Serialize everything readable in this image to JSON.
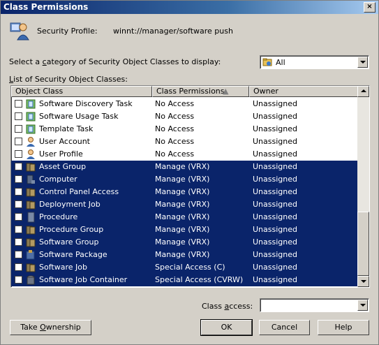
{
  "window": {
    "title": "Class Permissions",
    "close_glyph": "×"
  },
  "profile": {
    "label": "Security Profile:",
    "value": "winnt://manager/software push"
  },
  "category": {
    "label_pre": "Select a ",
    "label_accel": "c",
    "label_post": "ategory of Security Object Classes to display:",
    "selected": "All"
  },
  "list": {
    "label_pre": "",
    "label_accel": "L",
    "label_post": "ist of Security Object Classes:",
    "columns": [
      "Object Class",
      "Class Permissions",
      "Owner"
    ],
    "rows": [
      {
        "name": "Software Discovery Task",
        "perm": "No Access",
        "owner": "Unassigned",
        "selected": false,
        "icon": "task-icon"
      },
      {
        "name": "Software Usage Task",
        "perm": "No Access",
        "owner": "Unassigned",
        "selected": false,
        "icon": "task-icon"
      },
      {
        "name": "Template Task",
        "perm": "No Access",
        "owner": "Unassigned",
        "selected": false,
        "icon": "task-icon"
      },
      {
        "name": "User Account",
        "perm": "No Access",
        "owner": "Unassigned",
        "selected": false,
        "icon": "user-icon"
      },
      {
        "name": "User Profile",
        "perm": "No Access",
        "owner": "Unassigned",
        "selected": false,
        "icon": "user-icon"
      },
      {
        "name": "Asset Group",
        "perm": "Manage (VRX)",
        "owner": "Unassigned",
        "selected": true,
        "icon": "group-icon"
      },
      {
        "name": "Computer",
        "perm": "Manage (VRX)",
        "owner": "Unassigned",
        "selected": true,
        "icon": "computer-icon"
      },
      {
        "name": "Control Panel Access",
        "perm": "Manage (VRX)",
        "owner": "Unassigned",
        "selected": true,
        "icon": "group-icon"
      },
      {
        "name": "Deployment Job",
        "perm": "Manage (VRX)",
        "owner": "Unassigned",
        "selected": true,
        "icon": "group-icon"
      },
      {
        "name": "Procedure",
        "perm": "Manage (VRX)",
        "owner": "Unassigned",
        "selected": true,
        "icon": "document-icon"
      },
      {
        "name": "Procedure Group",
        "perm": "Manage (VRX)",
        "owner": "Unassigned",
        "selected": true,
        "icon": "group-icon"
      },
      {
        "name": "Software Group",
        "perm": "Manage (VRX)",
        "owner": "Unassigned",
        "selected": true,
        "icon": "group-icon"
      },
      {
        "name": "Software Package",
        "perm": "Manage (VRX)",
        "owner": "Unassigned",
        "selected": true,
        "icon": "package-icon"
      },
      {
        "name": "Software Job",
        "perm": "Special Access (C)",
        "owner": "Unassigned",
        "selected": true,
        "icon": "group-icon"
      },
      {
        "name": "Software Job Container",
        "perm": "Special Access (CVRW)",
        "owner": "Unassigned",
        "selected": true,
        "icon": "container-icon"
      }
    ]
  },
  "class_access": {
    "label_pre": "Class ",
    "label_accel": "a",
    "label_post": "ccess:",
    "value": ""
  },
  "buttons": {
    "take_ownership": {
      "pre": "Take ",
      "accel": "O",
      "post": "wnership"
    },
    "ok": "OK",
    "cancel": "Cancel",
    "help": "Help"
  },
  "colors": {
    "selection": "#0a246a",
    "face": "#d4d0c8"
  }
}
